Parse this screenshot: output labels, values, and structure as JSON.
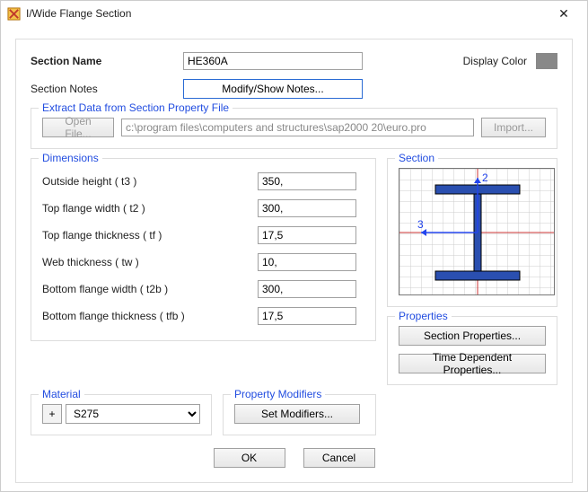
{
  "window": {
    "title": "I/Wide Flange Section"
  },
  "header": {
    "section_name_label": "Section Name",
    "section_name_value": "HE360A",
    "section_notes_label": "Section Notes",
    "modify_show_notes": "Modify/Show Notes...",
    "display_color_label": "Display Color",
    "display_color_hex": "#808080"
  },
  "extract": {
    "legend": "Extract Data from Section Property File",
    "open_file": "Open File...",
    "path": "c:\\program files\\computers and structures\\sap2000 20\\euro.pro",
    "import": "Import..."
  },
  "dimensions": {
    "legend": "Dimensions",
    "rows": [
      {
        "label": "Outside height  ( t3 )",
        "value": "350,"
      },
      {
        "label": "Top flange width  ( t2 )",
        "value": "300,"
      },
      {
        "label": "Top flange thickness  ( tf )",
        "value": "17,5"
      },
      {
        "label": "Web thickness  ( tw )",
        "value": "10,"
      },
      {
        "label": "Bottom flange width  ( t2b )",
        "value": "300,"
      },
      {
        "label": "Bottom flange thickness  ( tfb )",
        "value": "17,5"
      }
    ]
  },
  "section_group": {
    "legend": "Section",
    "axis2": "2",
    "axis3": "3"
  },
  "properties": {
    "legend": "Properties",
    "section_props": "Section Properties...",
    "time_dependent": "Time Dependent Properties..."
  },
  "material": {
    "legend": "Material",
    "plus": "+",
    "value": "S275"
  },
  "modifiers": {
    "legend": "Property Modifiers",
    "set": "Set Modifiers..."
  },
  "footer": {
    "ok": "OK",
    "cancel": "Cancel"
  }
}
